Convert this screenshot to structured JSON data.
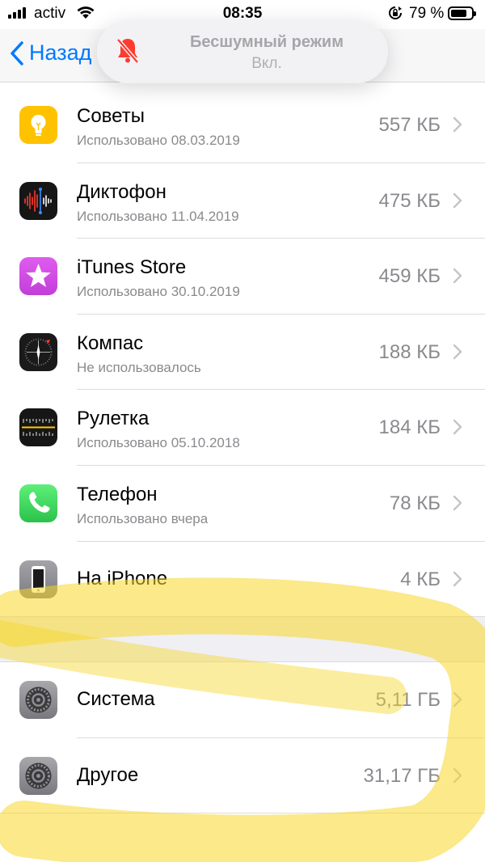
{
  "status_bar": {
    "carrier": "activ",
    "time": "08:35",
    "battery_percent": "79 %",
    "battery_level": 0.79
  },
  "nav": {
    "back_label": "Назад"
  },
  "banner": {
    "title": "Бесшумный режим",
    "subtitle": "Вкл."
  },
  "apps": [
    {
      "name": "Советы",
      "usage": "Использовано 08.03.2019",
      "size": "557 КБ",
      "icon": "tips-icon"
    },
    {
      "name": "Диктофон",
      "usage": "Использовано 11.04.2019",
      "size": "475 КБ",
      "icon": "voice-memos-icon"
    },
    {
      "name": "iTunes Store",
      "usage": "Использовано 30.10.2019",
      "size": "459 КБ",
      "icon": "itunes-store-icon"
    },
    {
      "name": "Компас",
      "usage": "Не использовалось",
      "size": "188 КБ",
      "icon": "compass-icon"
    },
    {
      "name": "Рулетка",
      "usage": "Использовано 05.10.2018",
      "size": "184 КБ",
      "icon": "measure-icon"
    },
    {
      "name": "Телефон",
      "usage": "Использовано вчера",
      "size": "78 КБ",
      "icon": "phone-icon"
    },
    {
      "name": "На iPhone",
      "size": "4 КБ",
      "icon": "on-iphone-icon"
    }
  ],
  "system": [
    {
      "name": "Система",
      "size": "5,11 ГБ",
      "icon": "system-gear-icon"
    },
    {
      "name": "Другое",
      "size": "31,17 ГБ",
      "icon": "other-gear-icon"
    }
  ],
  "colors": {
    "accent": "#007aff",
    "tips": "#ffc200",
    "itunes": "#d84ee6",
    "phone": "#2fcc52",
    "marker": "#f7d72a"
  }
}
